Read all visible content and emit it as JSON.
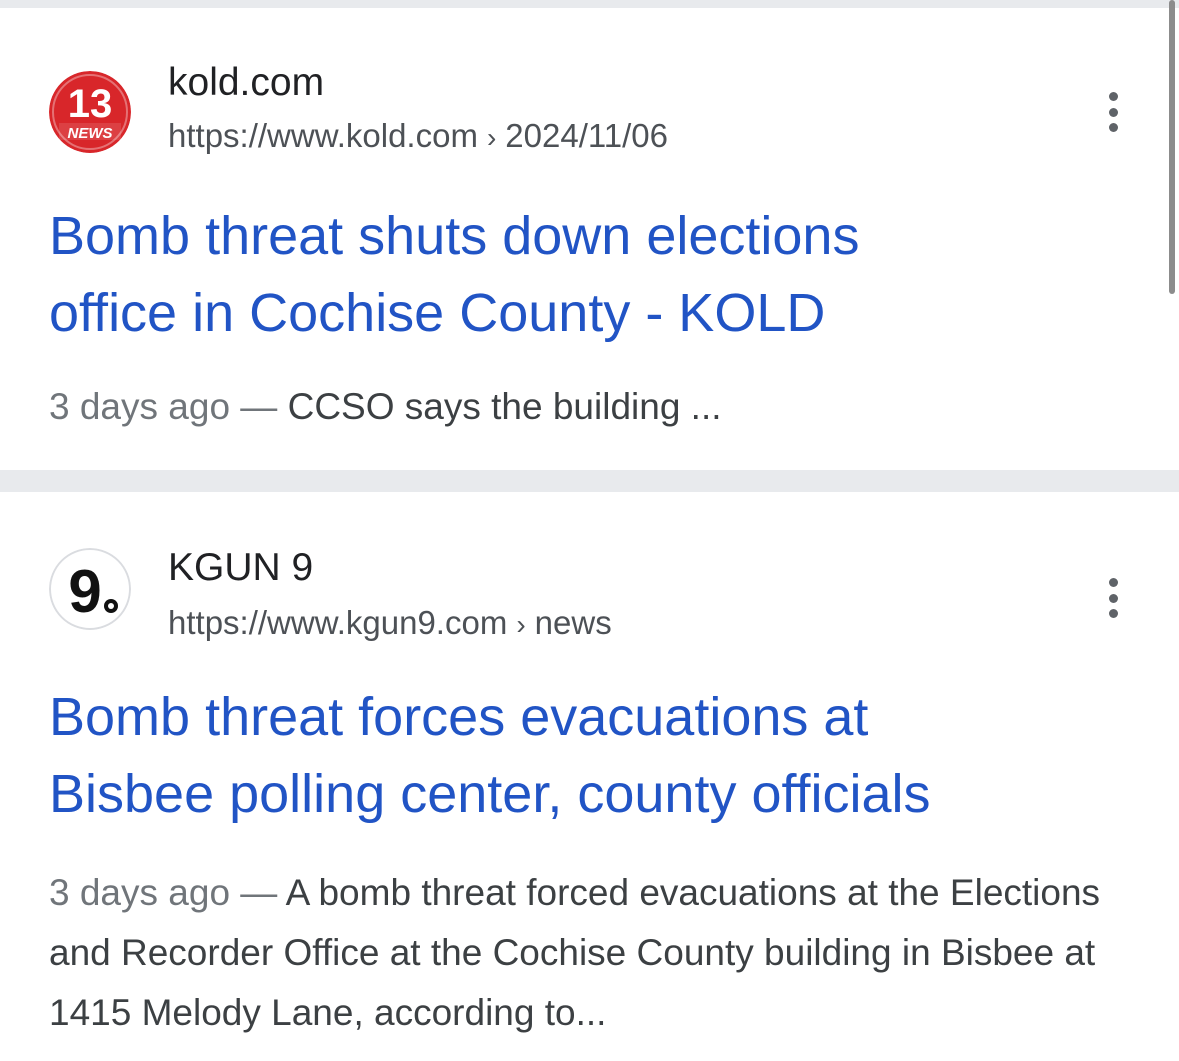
{
  "results": [
    {
      "site_name": "kold.com",
      "url": "https://www.kold.com",
      "path": "2024/11/06",
      "favicon_icon": "kold-13-news-logo",
      "title_line1": "Bomb threat shuts down elections",
      "title_line2": "office in Cochise County - KOLD",
      "snippet_date": "3 days ago",
      "snippet_dash": " — ",
      "snippet_text": "CCSO says the building ..."
    },
    {
      "site_name": "KGUN 9",
      "url": "https://www.kgun9.com",
      "path": "news",
      "favicon_icon": "kgun-9-logo",
      "title_line1": "Bomb threat forces evacuations at",
      "title_line2": "Bisbee polling center, county officials",
      "snippet_date": "3 days ago",
      "snippet_dash": " — ",
      "snippet_text": "A bomb threat forced evacuations at the Elections and Recorder Office at the Cochise County building in Bisbee at 1415 Melody Lane, according to..."
    }
  ],
  "logo_text": {
    "kold_number": "13",
    "kold_word": "NEWS",
    "kgun_number": "9"
  },
  "colors": {
    "title_link": "#2154c5",
    "kold_red": "#d8262a",
    "divider": "#e8eaed"
  }
}
